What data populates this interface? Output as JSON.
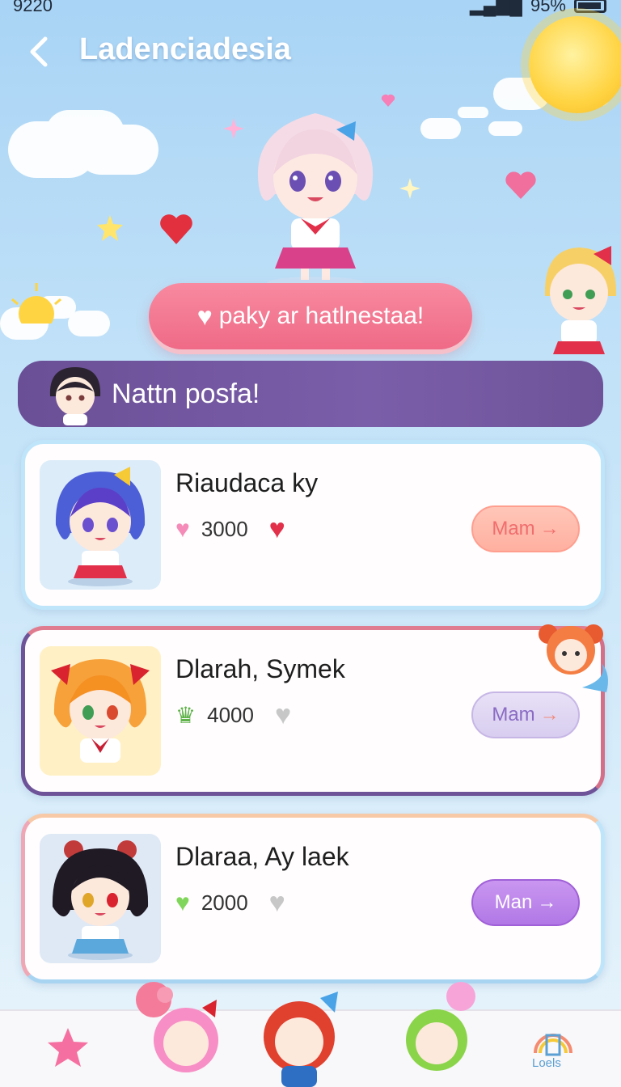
{
  "status_bar": {
    "time": "9220",
    "battery": "95%"
  },
  "header": {
    "title": "Ladenciadesia"
  },
  "cta": {
    "label": "paky ar hatlnestaa!"
  },
  "section": {
    "title": "Nattn posfa!"
  },
  "cards": [
    {
      "name": "Riaudaca ky",
      "count": "3000",
      "button": "Mam"
    },
    {
      "name": "Dlarah, Symek",
      "count": "4000",
      "button": "Mam"
    },
    {
      "name": "Dlaraa, Ay laek",
      "count": "2000",
      "button": "Man"
    }
  ],
  "nav": {
    "right_label": "Loels"
  },
  "colors": {
    "cta": "#ef6a86",
    "section": "#6e5399",
    "accent_purple": "#b178e6"
  }
}
